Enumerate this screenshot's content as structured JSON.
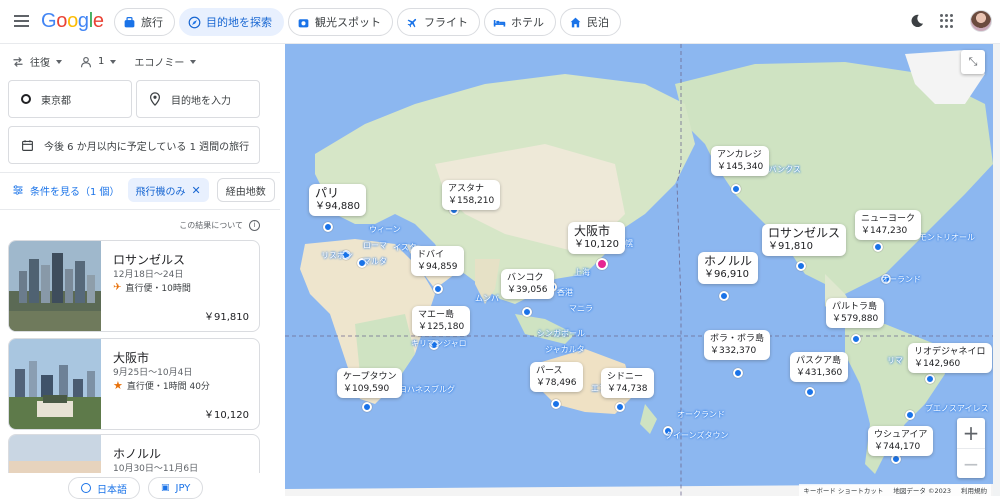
{
  "header": {
    "logo": "Google",
    "tabs": [
      {
        "label": "旅行",
        "icon": "suitcase-icon",
        "active": false
      },
      {
        "label": "目的地を探索",
        "icon": "explore-icon",
        "active": true
      },
      {
        "label": "観光スポット",
        "icon": "camera-icon",
        "active": false
      },
      {
        "label": "フライト",
        "icon": "plane-icon",
        "active": false
      },
      {
        "label": "ホテル",
        "icon": "bed-icon",
        "active": false
      },
      {
        "label": "民泊",
        "icon": "home-icon",
        "active": false
      }
    ]
  },
  "search": {
    "trip_type": "往復",
    "passengers": "1",
    "cabin": "エコノミー",
    "origin": "東京都",
    "destination_placeholder": "目的地を入力",
    "date_text": "今後 6 か月以内に予定している 1 週間の旅行"
  },
  "filters": {
    "see_filters": "条件を見る（1 個）",
    "chip_nonstop": "飛行機のみ",
    "chip_stops": "経由地数"
  },
  "about_results": "この結果について",
  "results": [
    {
      "name": "ロサンゼルス",
      "dates": "12月18日～24日",
      "stops": "直行便・10時間",
      "price": "￥91,810"
    },
    {
      "name": "大阪市",
      "dates": "9月25日～10月4日",
      "stops": "直行便・1時間 40分",
      "price": "￥10,120"
    },
    {
      "name": "ホノルル",
      "dates": "10月30日～11月6日",
      "stops": "",
      "price": ""
    }
  ],
  "footer": {
    "language": "日本語",
    "currency": "JPY"
  },
  "map": {
    "price_labels": [
      {
        "name": "パリ",
        "price": "￥94,880"
      },
      {
        "name": "アスタナ",
        "price": "￥158,210"
      },
      {
        "name": "ドバイ",
        "price": "￥94,859"
      },
      {
        "name": "大阪市",
        "price": "￥10,120"
      },
      {
        "name": "バンコク",
        "price": "￥39,056"
      },
      {
        "name": "マエー島",
        "price": "￥125,180"
      },
      {
        "name": "ケープタウン",
        "price": "￥109,590"
      },
      {
        "name": "パース",
        "price": "￥78,496"
      },
      {
        "name": "シドニー",
        "price": "￥74,738"
      },
      {
        "name": "アンカレジ",
        "price": "￥145,340"
      },
      {
        "name": "ホノルル",
        "price": "￥96,910"
      },
      {
        "name": "ロサンゼルス",
        "price": "￥91,810"
      },
      {
        "name": "ニューヨーク",
        "price": "￥147,230"
      },
      {
        "name": "パルトラ島",
        "price": "￥579,880"
      },
      {
        "name": "ボラ・ボラ島",
        "price": "￥332,370"
      },
      {
        "name": "パスクア島",
        "price": "￥431,360"
      },
      {
        "name": "リオデジャネイロ",
        "price": "￥142,960"
      },
      {
        "name": "ウシュアイア",
        "price": "￥744,170"
      }
    ],
    "city_names": [
      "ウィーン",
      "ローマ",
      "イスタ",
      "リスボン",
      "マルタ",
      "ムンバ",
      "香港",
      "マニラ",
      "上海",
      "シンガポール",
      "ジャカルタ",
      "キリマンジャロ",
      "ヨハネスブルグ",
      "オークランド",
      "クイーンズタウン",
      "フェアバンクス",
      "オーランド",
      "モントリオール",
      "リマ",
      "ブエノスアイレス",
      "札幌",
      "エアーズロック"
    ],
    "attribution": [
      "キーボード ショートカット",
      "地図データ ©2023",
      "利用規約"
    ]
  }
}
